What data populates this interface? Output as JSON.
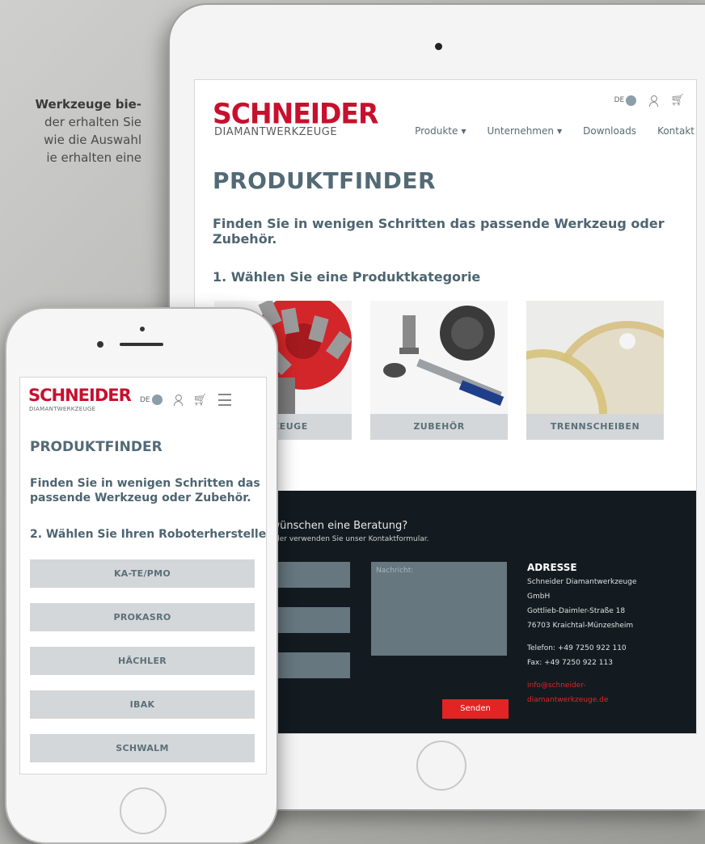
{
  "background_text": {
    "line1": "Werkzeuge bie-",
    "line2": "der erhalten Sie",
    "line3": "wie die Auswahl",
    "line4": "ie erhalten eine"
  },
  "tablet": {
    "logo": "SCHNEIDER",
    "logo_sub": "DIAMANTWERKZEUGE",
    "lang": "DE",
    "nav": [
      {
        "label": "Produkte",
        "dropdown": true
      },
      {
        "label": "Unternehmen",
        "dropdown": true
      },
      {
        "label": "Downloads"
      },
      {
        "label": "Kontakt"
      }
    ],
    "title": "PRODUKTFINDER",
    "intro": "Finden Sie in wenigen Schritten das passende Werkzeug oder Zubehör.",
    "step": "1. Wählen Sie eine Produktkategorie",
    "categories": [
      {
        "label": "RKZEUGE"
      },
      {
        "label": "ZUBEHÖR"
      },
      {
        "label": "TRENNSCHEIBEN"
      }
    ],
    "footer": {
      "question": "h Fragen oder wünschen eine Beratung?",
      "sub": "n Sie uns persönlich oder verwenden Sie unser Kontaktformular.",
      "message_placeholder": "Nachricht:",
      "send": "Senden",
      "address_heading": "ADRESSE",
      "address_lines": [
        "Schneider Diamantwerkzeuge",
        "GmbH",
        "Gottlieb-Daimler-Straße 18",
        "76703 Kraichtal-Münzesheim"
      ],
      "phone": "Telefon: +49 7250 922 110",
      "fax": "Fax: +49 7250 922 113",
      "email_line1": "info@schneider-",
      "email_line2": "diamantwerkzeuge.de"
    }
  },
  "phone": {
    "logo": "SCHNEIDER",
    "logo_sub": "DIAMANTWERKZEUGE",
    "lang": "DE",
    "title": "PRODUKTFINDER",
    "intro": "Finden Sie in wenigen Schritten das passende Werkzeug oder Zubehör.",
    "step": "2. Wählen Sie Ihren Roboterhersteller",
    "manufacturers": [
      "KA-TE/PMO",
      "PROKASRO",
      "HÄCHLER",
      "IBAK",
      "SCHWALM"
    ]
  },
  "colors": {
    "brand_red": "#c8102e",
    "heading_slate": "#536a76",
    "footer_dark": "#131b20",
    "button_red": "#e32424"
  }
}
